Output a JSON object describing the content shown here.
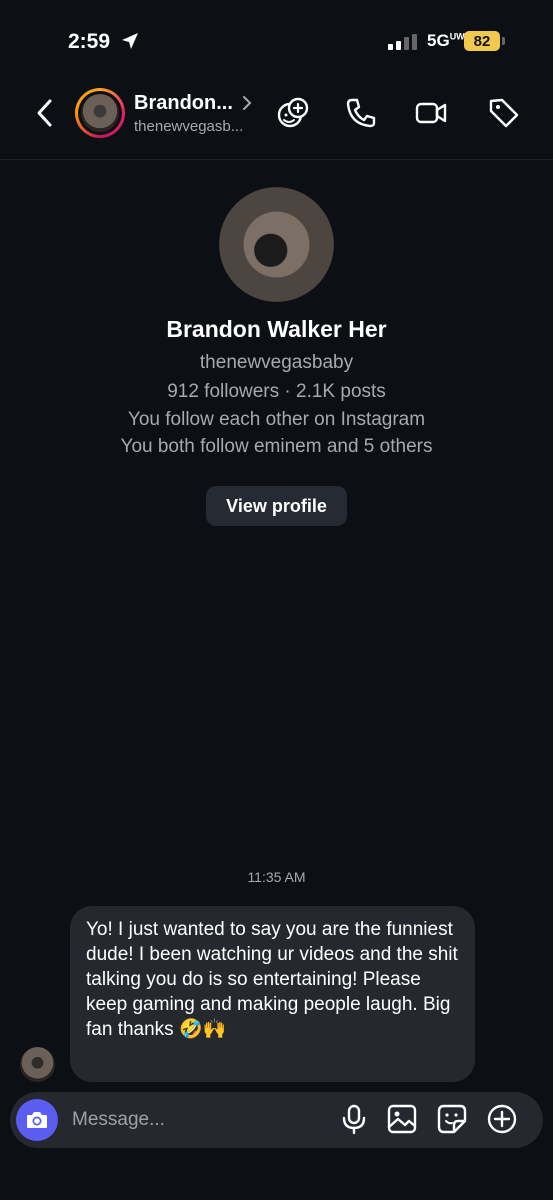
{
  "status_bar": {
    "time": "2:59",
    "network": "5G",
    "network_sup": "UW",
    "battery": "82"
  },
  "header": {
    "name": "Brandon...",
    "username": "thenewvegasb..."
  },
  "profile": {
    "name": "Brandon Walker Her",
    "username": "thenewvegasbaby",
    "stats": "912 followers · 2.1K posts",
    "mutual_line1": "You follow each other on Instagram",
    "mutual_line2": "You both follow eminem and 5 others",
    "view_profile_label": "View profile"
  },
  "messages": {
    "timestamp": "11:35 AM",
    "items": [
      {
        "text": "Yo! I just wanted to say you are the funniest dude! I been watching ur videos and the shit talking you do is so entertaining! Please keep gaming and making people laugh. Big fan thanks 🤣🙌"
      }
    ]
  },
  "composer": {
    "placeholder": "Message..."
  },
  "icons": {
    "back": "chevron-left-icon",
    "effects": "face-effects-icon",
    "call": "phone-icon",
    "video": "video-camera-icon",
    "tag": "tag-icon",
    "camera": "camera-icon",
    "mic": "microphone-icon",
    "gallery": "image-icon",
    "sticker": "sticker-icon",
    "add": "plus-circle-icon"
  },
  "colors": {
    "background": "#0c0f14",
    "bubble": "#25282e",
    "camera_button": "#5b5cf0",
    "battery": "#f2c94c"
  }
}
